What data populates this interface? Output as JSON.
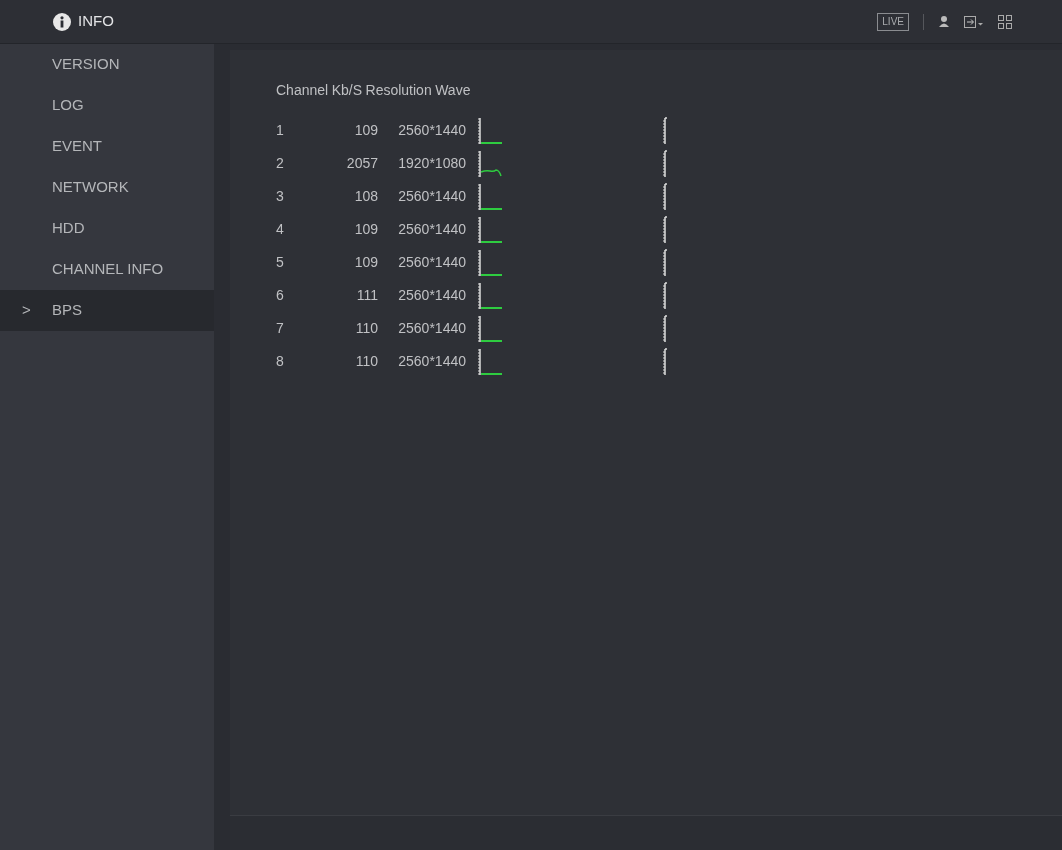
{
  "header": {
    "title": "INFO",
    "live_button": "LIVE"
  },
  "sidebar": {
    "items": [
      {
        "label": "VERSION",
        "selected": false
      },
      {
        "label": "LOG",
        "selected": false
      },
      {
        "label": "EVENT",
        "selected": false
      },
      {
        "label": "NETWORK",
        "selected": false
      },
      {
        "label": "HDD",
        "selected": false
      },
      {
        "label": "CHANNEL INFO",
        "selected": false
      },
      {
        "label": ">",
        "label_text": "BPS",
        "selected": true
      }
    ]
  },
  "table": {
    "columns": [
      "Channel",
      "Kb/S",
      "Resolution",
      "Wave"
    ],
    "rows": [
      {
        "channel": "1",
        "kbps": "109",
        "resolution": "2560*1440"
      },
      {
        "channel": "2",
        "kbps": "2057",
        "resolution": "1920*1080"
      },
      {
        "channel": "3",
        "kbps": "108",
        "resolution": "2560*1440"
      },
      {
        "channel": "4",
        "kbps": "109",
        "resolution": "2560*1440"
      },
      {
        "channel": "5",
        "kbps": "109",
        "resolution": "2560*1440"
      },
      {
        "channel": "6",
        "kbps": "111",
        "resolution": "2560*1440"
      },
      {
        "channel": "7",
        "kbps": "110",
        "resolution": "2560*1440"
      },
      {
        "channel": "8",
        "kbps": "110",
        "resolution": "2560*1440"
      }
    ]
  }
}
